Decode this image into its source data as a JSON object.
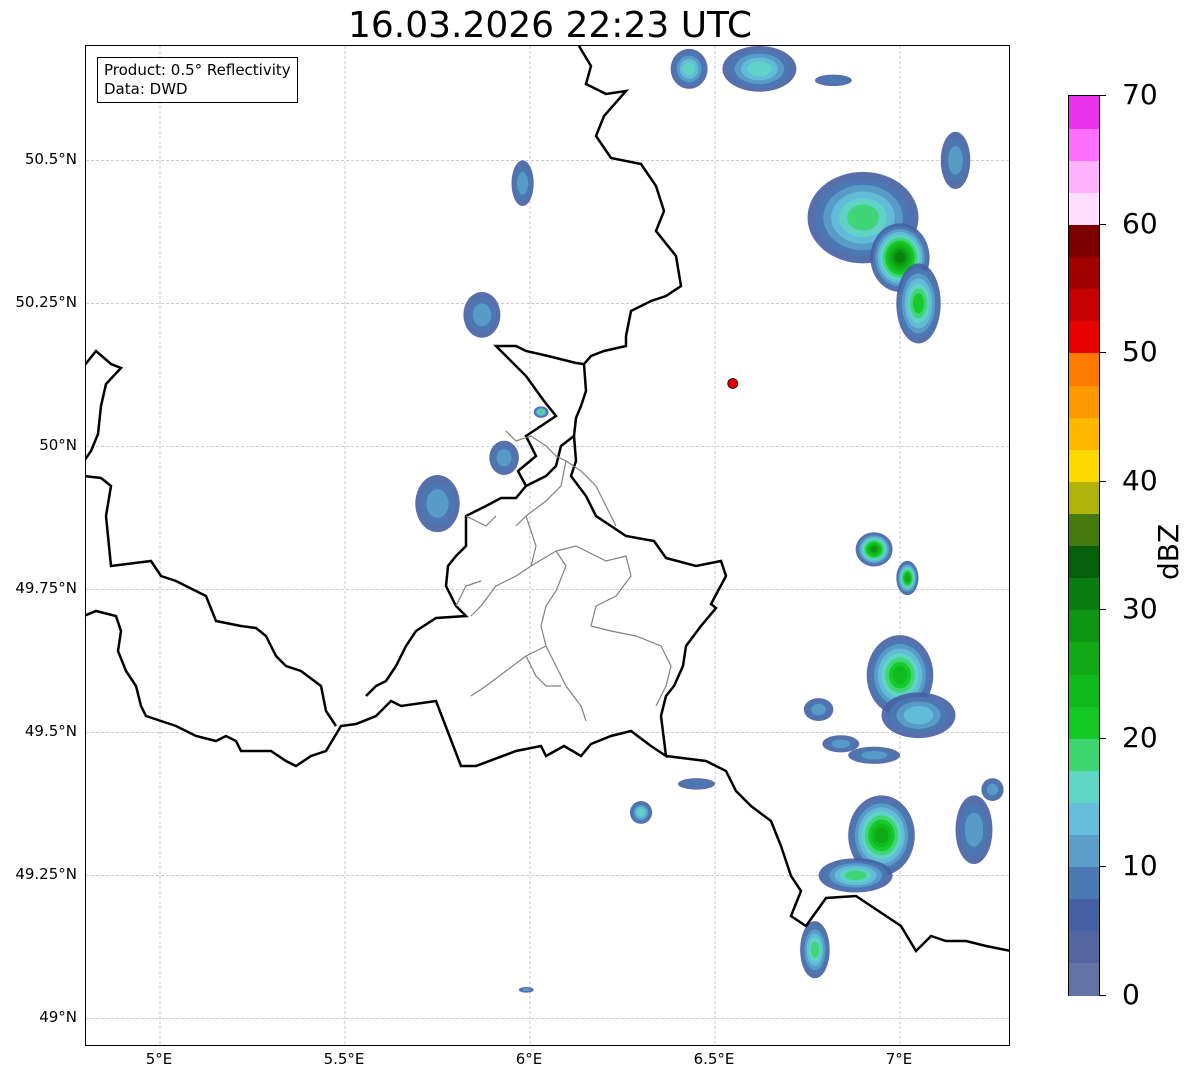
{
  "title": "16.03.2026 22:23 UTC",
  "info_box": {
    "product": "Product: 0.5° Reflectivity",
    "data": "Data: DWD"
  },
  "map": {
    "lon_range": [
      4.8,
      7.3
    ],
    "lat_range": [
      48.95,
      50.7
    ],
    "lat_ticks": [
      {
        "value": 50.5,
        "label": "50.5°N"
      },
      {
        "value": 50.25,
        "label": "50.25°N"
      },
      {
        "value": 50.0,
        "label": "50°N"
      },
      {
        "value": 49.75,
        "label": "49.75°N"
      },
      {
        "value": 49.5,
        "label": "49.5°N"
      },
      {
        "value": 49.25,
        "label": "49.25°N"
      },
      {
        "value": 49.0,
        "label": "49°N"
      }
    ],
    "lon_ticks": [
      {
        "value": 5.0,
        "label": "5°E"
      },
      {
        "value": 5.5,
        "label": "5.5°E"
      },
      {
        "value": 6.0,
        "label": "6°E"
      },
      {
        "value": 6.5,
        "label": "6.5°E"
      },
      {
        "value": 7.0,
        "label": "7°E"
      }
    ],
    "grid": true,
    "radar_site": {
      "lon": 6.548,
      "lat": 50.11,
      "color": "#e60000"
    },
    "border_color": "#000000",
    "admin_border_color": "#808080"
  },
  "colorbar": {
    "label": "dBZ",
    "min": 0,
    "max": 70,
    "step": 2.5,
    "tick_values": [
      "0",
      "10",
      "20",
      "30",
      "40",
      "50",
      "60",
      "70"
    ],
    "colors": [
      "#6373a6",
      "#5366a0",
      "#4561a3",
      "#4a79b3",
      "#5a9ec9",
      "#65bfdc",
      "#5fd5c3",
      "#3dd66e",
      "#13c923",
      "#10b91c",
      "#11a916",
      "#0e9513",
      "#097d0f",
      "#065f0b",
      "#477a0c",
      "#afb30a",
      "#ffd800",
      "#ffb700",
      "#ff9900",
      "#ff7b00",
      "#e60000",
      "#c40000",
      "#a30000",
      "#7d0000",
      "#ffdeff",
      "#ffb3ff",
      "#ff6eff",
      "#eb33eb"
    ]
  },
  "echoes": [
    {
      "lon": 6.43,
      "lat": 50.66,
      "rx": 0.05,
      "ry": 0.035,
      "level": 5
    },
    {
      "lon": 6.62,
      "lat": 50.66,
      "rx": 0.1,
      "ry": 0.04,
      "level": 5
    },
    {
      "lon": 6.82,
      "lat": 50.64,
      "rx": 0.05,
      "ry": 0.01,
      "level": 2
    },
    {
      "lon": 5.98,
      "lat": 50.46,
      "rx": 0.03,
      "ry": 0.04,
      "level": 3
    },
    {
      "lon": 5.87,
      "lat": 50.23,
      "rx": 0.05,
      "ry": 0.04,
      "level": 3
    },
    {
      "lon": 6.9,
      "lat": 50.4,
      "rx": 0.15,
      "ry": 0.08,
      "level": 6
    },
    {
      "lon": 7.0,
      "lat": 50.33,
      "rx": 0.08,
      "ry": 0.06,
      "level": 11
    },
    {
      "lon": 7.05,
      "lat": 50.25,
      "rx": 0.06,
      "ry": 0.07,
      "level": 7
    },
    {
      "lon": 7.15,
      "lat": 50.5,
      "rx": 0.04,
      "ry": 0.05,
      "level": 3
    },
    {
      "lon": 5.75,
      "lat": 49.9,
      "rx": 0.06,
      "ry": 0.05,
      "level": 3
    },
    {
      "lon": 5.93,
      "lat": 49.98,
      "rx": 0.04,
      "ry": 0.03,
      "level": 3
    },
    {
      "lon": 6.03,
      "lat": 50.06,
      "rx": 0.02,
      "ry": 0.01,
      "level": 6
    },
    {
      "lon": 6.93,
      "lat": 49.82,
      "rx": 0.05,
      "ry": 0.03,
      "level": 10
    },
    {
      "lon": 7.02,
      "lat": 49.77,
      "rx": 0.03,
      "ry": 0.03,
      "level": 9
    },
    {
      "lon": 7.0,
      "lat": 49.6,
      "rx": 0.09,
      "ry": 0.07,
      "level": 8
    },
    {
      "lon": 7.05,
      "lat": 49.53,
      "rx": 0.1,
      "ry": 0.04,
      "level": 4
    },
    {
      "lon": 6.78,
      "lat": 49.54,
      "rx": 0.04,
      "ry": 0.02,
      "level": 3
    },
    {
      "lon": 6.84,
      "lat": 49.48,
      "rx": 0.05,
      "ry": 0.015,
      "level": 3
    },
    {
      "lon": 6.93,
      "lat": 49.46,
      "rx": 0.07,
      "ry": 0.015,
      "level": 3
    },
    {
      "lon": 6.95,
      "lat": 49.32,
      "rx": 0.09,
      "ry": 0.07,
      "level": 9
    },
    {
      "lon": 6.88,
      "lat": 49.25,
      "rx": 0.1,
      "ry": 0.03,
      "level": 6
    },
    {
      "lon": 7.2,
      "lat": 49.33,
      "rx": 0.05,
      "ry": 0.06,
      "level": 3
    },
    {
      "lon": 7.25,
      "lat": 49.4,
      "rx": 0.03,
      "ry": 0.02,
      "level": 3
    },
    {
      "lon": 6.77,
      "lat": 49.12,
      "rx": 0.04,
      "ry": 0.05,
      "level": 6
    },
    {
      "lon": 6.3,
      "lat": 49.36,
      "rx": 0.03,
      "ry": 0.02,
      "level": 5
    },
    {
      "lon": 6.45,
      "lat": 49.41,
      "rx": 0.05,
      "ry": 0.01,
      "level": 2
    },
    {
      "lon": 5.99,
      "lat": 49.05,
      "rx": 0.02,
      "ry": 0.005,
      "level": 3
    }
  ]
}
